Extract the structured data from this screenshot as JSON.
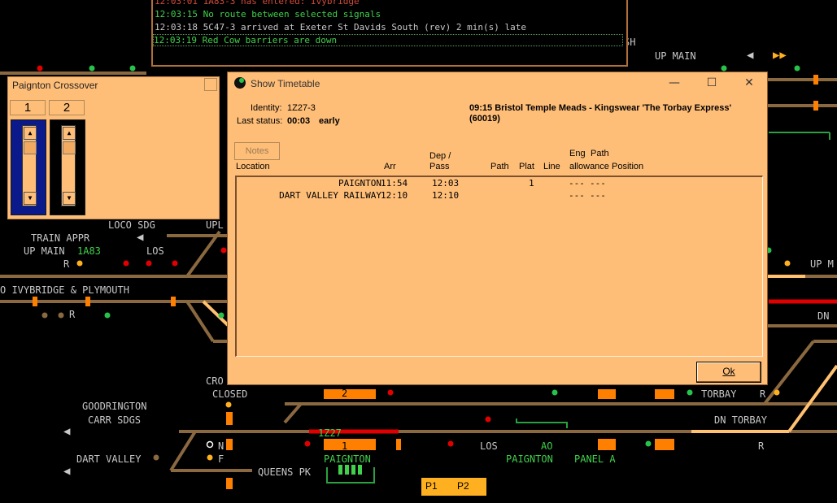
{
  "messages": [
    {
      "text": "12:03:01 1A83-3 has entered: Ivybridge",
      "color": "#d24a3a"
    },
    {
      "text": "12:03:15 No route between selected signals",
      "color": "#3fd24a"
    },
    {
      "text": "12:03:18 5C47-3 arrived at Exeter St Davids South (rev) 2 min(s) late",
      "color": "#c8c8c8"
    },
    {
      "text": "12:03:19 Red Cow barriers are down",
      "color": "#3fd24a"
    }
  ],
  "crossover": {
    "title": "Paignton Crossover",
    "columns": [
      {
        "label": "1",
        "color": "#0a1a8a"
      },
      {
        "label": "2",
        "color": "#000000"
      }
    ]
  },
  "dialog": {
    "title": "Show Timetable",
    "identity_label": "Identity:",
    "identity": "1Z27-3",
    "status_label": "Last status:",
    "status_time": "00:03",
    "status_text": "early",
    "service": "09:15 Bristol Temple Meads - Kingswear 'The Torbay Express'",
    "service_code": "(60019)",
    "notes_label": "Notes",
    "headers": {
      "location": "Location",
      "arr": "Arr",
      "dep": "Dep /",
      "pass": "Pass",
      "path": "Path",
      "plat": "Plat",
      "line": "Line",
      "eng": "Eng",
      "path2": "Path",
      "allowance": "allowance",
      "position": "Position"
    },
    "rows": [
      {
        "location": "PAIGNTON",
        "arr": "11:54",
        "dep": "12:03",
        "path": "",
        "plat": "1",
        "line": "",
        "eng": "---",
        "pathallow": "---"
      },
      {
        "location": "DART VALLEY RAILWAY",
        "arr": "12:10",
        "dep": "12:10",
        "path": "",
        "plat": "",
        "line": "",
        "eng": "---",
        "pathallow": "---"
      }
    ],
    "ok_label": "Ok"
  },
  "map": {
    "labels": [
      {
        "text": "UP MAIN",
        "color": "#c8c8c8"
      },
      {
        "text": "LOCO SDG",
        "color": "#c8c8c8"
      },
      {
        "text": "TRAIN APPR",
        "color": "#c8c8c8"
      },
      {
        "text": "UP MAIN",
        "color": "#c8c8c8"
      },
      {
        "text": "1A83",
        "color": "#3fd24a"
      },
      {
        "text": "LOS",
        "color": "#c8c8c8"
      },
      {
        "text": "R",
        "color": "#c8c8c8"
      },
      {
        "text": "O IVYBRIDGE & PLYMOUTH",
        "color": "#c8c8c8"
      },
      {
        "text": "R",
        "color": "#c8c8c8"
      },
      {
        "text": "UPL",
        "color": "#c8c8c8"
      },
      {
        "text": "UP M",
        "color": "#c8c8c8"
      },
      {
        "text": "DN",
        "color": "#c8c8c8"
      },
      {
        "text": "CRO",
        "color": "#c8c8c8"
      },
      {
        "text": "CLOSED",
        "color": "#c8c8c8"
      },
      {
        "text": "GOODRINGTON",
        "color": "#c8c8c8"
      },
      {
        "text": "CARR SDGS",
        "color": "#c8c8c8"
      },
      {
        "text": "DART VALLEY",
        "color": "#c8c8c8"
      },
      {
        "text": "QUEENS PK",
        "color": "#c8c8c8"
      },
      {
        "text": "N",
        "color": "#c8c8c8"
      },
      {
        "text": "F",
        "color": "#c8c8c8"
      },
      {
        "text": "1Z27",
        "color": "#3fd24a"
      },
      {
        "text": "1",
        "color": "#000000"
      },
      {
        "text": "2",
        "color": "#000000"
      },
      {
        "text": "PAIGNTON",
        "color": "#3fd24a"
      },
      {
        "text": "LOS",
        "color": "#c8c8c8"
      },
      {
        "text": "AO",
        "color": "#3fd24a"
      },
      {
        "text": "PAIGNTON",
        "color": "#3fd24a"
      },
      {
        "text": "PANEL A",
        "color": "#3fd24a"
      },
      {
        "text": "TORBAY",
        "color": "#c8c8c8"
      },
      {
        "text": "R",
        "color": "#c8c8c8"
      },
      {
        "text": "DN TORBAY",
        "color": "#c8c8c8"
      },
      {
        "text": "R",
        "color": "#c8c8c8"
      },
      {
        "text": "SH",
        "color": "#c8c8c8"
      }
    ],
    "platform_keys": [
      "P1",
      "P2"
    ]
  }
}
